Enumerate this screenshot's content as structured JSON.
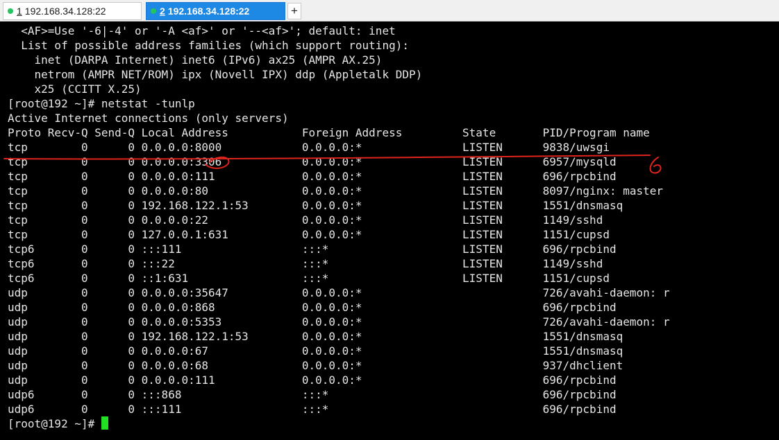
{
  "tabs": [
    {
      "index": "1",
      "title": "192.168.34.128:22",
      "active": false
    },
    {
      "index": "2",
      "title": "192.168.34.128:22",
      "active": true
    }
  ],
  "new_tab_label": "+",
  "terminal": {
    "lines": [
      "  <AF>=Use '-6|-4' or '-A <af>' or '--<af>'; default: inet",
      "  List of possible address families (which support routing):",
      "    inet (DARPA Internet) inet6 (IPv6) ax25 (AMPR AX.25)",
      "    netrom (AMPR NET/ROM) ipx (Novell IPX) ddp (Appletalk DDP)",
      "    x25 (CCITT X.25)",
      "[root@192 ~]# netstat -tunlp",
      "Active Internet connections (only servers)",
      "Proto Recv-Q Send-Q Local Address           Foreign Address         State       PID/Program name",
      "tcp        0      0 0.0.0.0:8000            0.0.0.0:*               LISTEN      9838/uwsgi",
      "tcp        0      0 0.0.0.0:3306            0.0.0.0:*               LISTEN      6957/mysqld",
      "tcp        0      0 0.0.0.0:111             0.0.0.0:*               LISTEN      696/rpcbind",
      "tcp        0      0 0.0.0.0:80              0.0.0.0:*               LISTEN      8097/nginx: master",
      "tcp        0      0 192.168.122.1:53        0.0.0.0:*               LISTEN      1551/dnsmasq",
      "tcp        0      0 0.0.0.0:22              0.0.0.0:*               LISTEN      1149/sshd",
      "tcp        0      0 127.0.0.1:631           0.0.0.0:*               LISTEN      1151/cupsd",
      "tcp6       0      0 :::111                  :::*                    LISTEN      696/rpcbind",
      "tcp6       0      0 :::22                   :::*                    LISTEN      1149/sshd",
      "tcp6       0      0 ::1:631                 :::*                    LISTEN      1151/cupsd",
      "udp        0      0 0.0.0.0:35647           0.0.0.0:*                           726/avahi-daemon: r",
      "udp        0      0 0.0.0.0:868             0.0.0.0:*                           696/rpcbind",
      "udp        0      0 0.0.0.0:5353            0.0.0.0:*                           726/avahi-daemon: r",
      "udp        0      0 192.168.122.1:53        0.0.0.0:*                           1551/dnsmasq",
      "udp        0      0 0.0.0.0:67              0.0.0.0:*                           1551/dnsmasq",
      "udp        0      0 0.0.0.0:68              0.0.0.0:*                           937/dhclient",
      "udp        0      0 0.0.0.0:111             0.0.0.0:*                           696/rpcbind",
      "udp6       0      0 :::868                  :::*                                696/rpcbind",
      "udp6       0      0 :::111                  :::*                                696/rpcbind"
    ],
    "prompt": "[root@192 ~]# "
  },
  "colors": {
    "terminal_bg": "#000000",
    "terminal_text": "#e6e6e6",
    "cursor": "#22e022",
    "active_tab": "#1e88e5",
    "status_dot": "#22c55e",
    "annotation": "#e0241c"
  }
}
